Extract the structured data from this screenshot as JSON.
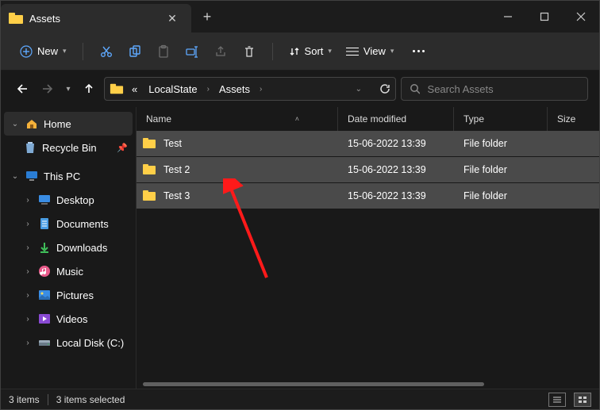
{
  "tab": {
    "title": "Assets"
  },
  "toolbar": {
    "new": "New",
    "sort": "Sort",
    "view": "View"
  },
  "breadcrumb": {
    "prefix": "«",
    "segments": [
      "LocalState",
      "Assets"
    ]
  },
  "search": {
    "placeholder": "Search Assets"
  },
  "sidebar": {
    "home": "Home",
    "recycle": "Recycle Bin",
    "thispc": "This PC",
    "desktop": "Desktop",
    "documents": "Documents",
    "downloads": "Downloads",
    "music": "Music",
    "pictures": "Pictures",
    "videos": "Videos",
    "localc": "Local Disk (C:)"
  },
  "columns": {
    "name": "Name",
    "date": "Date modified",
    "type": "Type",
    "size": "Size"
  },
  "rows": [
    {
      "name": "Test",
      "date": "15-06-2022 13:39",
      "type": "File folder"
    },
    {
      "name": "Test 2",
      "date": "15-06-2022 13:39",
      "type": "File folder"
    },
    {
      "name": "Test 3",
      "date": "15-06-2022 13:39",
      "type": "File folder"
    }
  ],
  "status": {
    "count": "3 items",
    "selected": "3 items selected"
  }
}
